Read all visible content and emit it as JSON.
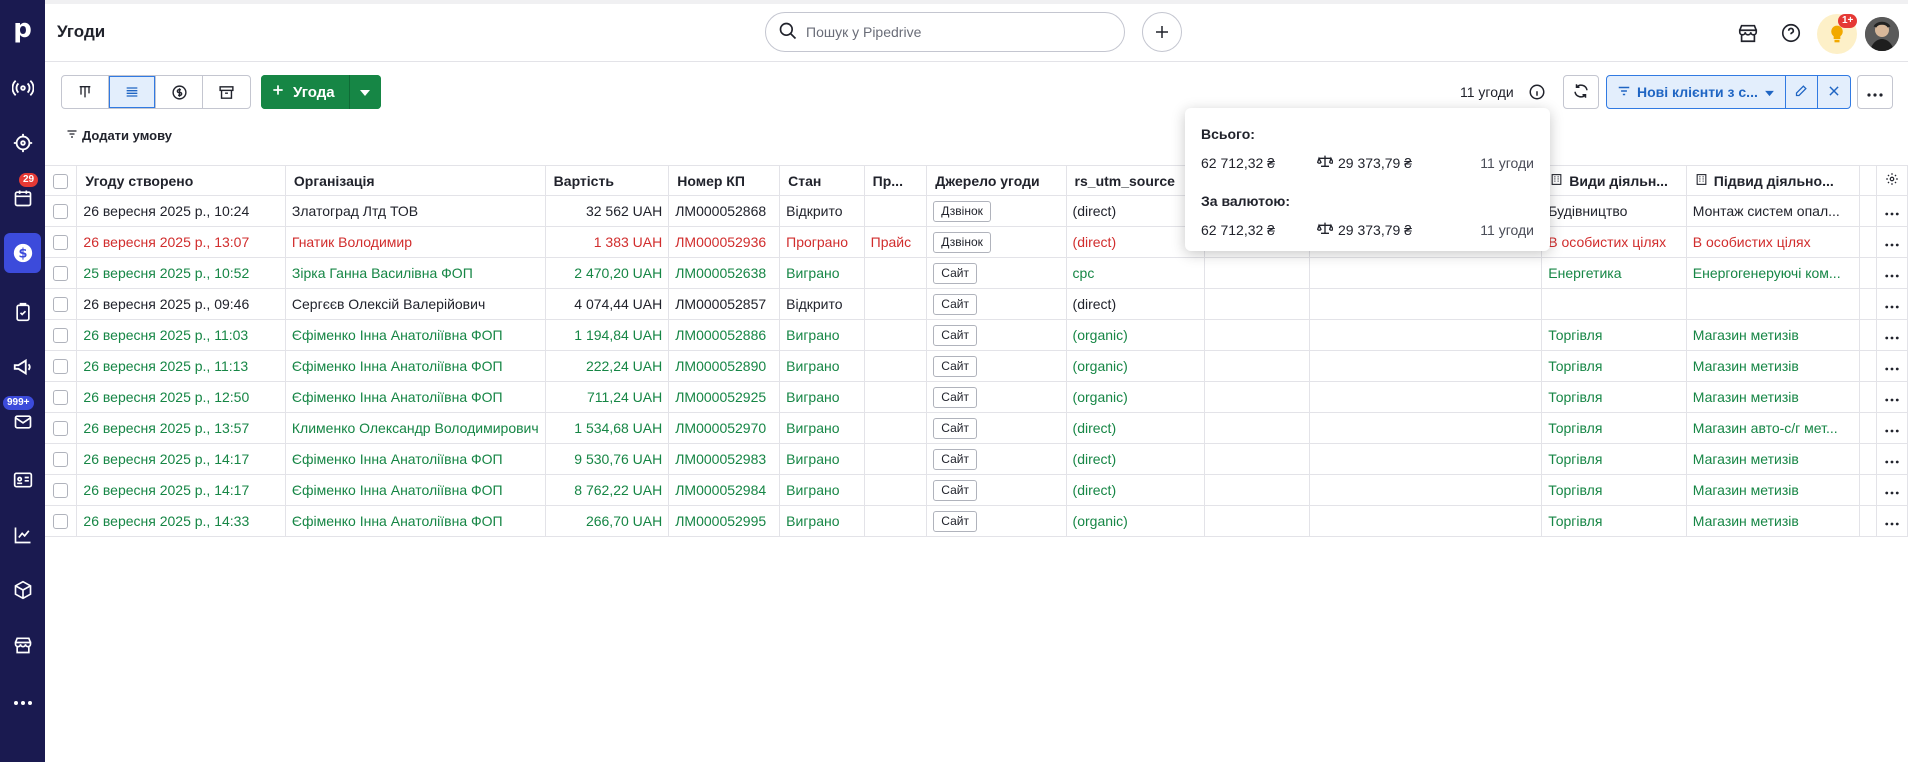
{
  "app": {
    "title": "Угоди"
  },
  "search": {
    "placeholder": "Пошук у Pipedrive"
  },
  "notifications": {
    "badge": "1+"
  },
  "sidebar": {
    "badges": {
      "activities": "29",
      "mail": "999+"
    }
  },
  "toolbar": {
    "add_deal_label": "Угода",
    "deal_count": "11 угоди",
    "filter_label": "Нові клієнти з с...",
    "add_condition": "Додати умову"
  },
  "table": {
    "columns": [
      "Угоду створено",
      "Організація",
      "Вартість",
      "Номер КП",
      "Стан",
      "Пр...",
      "Джерело угоди",
      "rs_utm_source",
      "rs",
      "",
      "Види діяльн...",
      "Підвид діяльно..."
    ],
    "rows": [
      {
        "created": "26 вересня 2025 р., 10:24",
        "org": "Златоград Лтд ТОВ",
        "value": "32 562 UAH",
        "kp": "ЛМ000052868",
        "status": "Відкрито",
        "pr": "",
        "source": "Дзвінок",
        "utm": "(direct)",
        "rs": "(d",
        "activity": "Будівництво",
        "sub": "Монтаж систем опал...",
        "color": "k"
      },
      {
        "created": "26 вересня 2025 р., 13:07",
        "org": "Гнатик Володимир",
        "value": "1 383 UAH",
        "kp": "ЛМ000052936",
        "status": "Програно",
        "pr": "Прайс",
        "source": "Дзвінок",
        "utm": "(direct)",
        "rs": "(d",
        "activity": "В особистих цілях",
        "sub": "В особистих цілях",
        "color": "r"
      },
      {
        "created": "25 вересня 2025 р., 10:52",
        "org": "Зірка Ганна Василівна ФОП",
        "value": "2 470,20 UAH",
        "kp": "ЛМ000052638",
        "status": "Виграно",
        "pr": "",
        "source": "Сайт",
        "utm": "cpc",
        "rs": "",
        "activity": "Енергетика",
        "sub": "Енергогенеруючі ком...",
        "color": "g"
      },
      {
        "created": "26 вересня 2025 р., 09:46",
        "org": "Сергєєв Олексій Валерійович",
        "value": "4 074,44 UAH",
        "kp": "ЛМ000052857",
        "status": "Відкрито",
        "pr": "",
        "source": "Сайт",
        "utm": "(direct)",
        "rs": "",
        "activity": "",
        "sub": "",
        "color": "k"
      },
      {
        "created": "26 вересня 2025 р., 11:03",
        "org": "Єфіменко Інна Анатоліївна ФОП",
        "value": "1 194,84 UAH",
        "kp": "ЛМ000052886",
        "status": "Виграно",
        "pr": "",
        "source": "Сайт",
        "utm": "(organic)",
        "rs": "",
        "activity": "Торгівля",
        "sub": "Магазин метизів",
        "color": "g"
      },
      {
        "created": "26 вересня 2025 р., 11:13",
        "org": "Єфіменко Інна Анатоліївна ФОП",
        "value": "222,24 UAH",
        "kp": "ЛМ000052890",
        "status": "Виграно",
        "pr": "",
        "source": "Сайт",
        "utm": "(organic)",
        "rs": "",
        "activity": "Торгівля",
        "sub": "Магазин метизів",
        "color": "g"
      },
      {
        "created": "26 вересня 2025 р., 12:50",
        "org": "Єфіменко Інна Анатоліївна ФОП",
        "value": "711,24 UAH",
        "kp": "ЛМ000052925",
        "status": "Виграно",
        "pr": "",
        "source": "Сайт",
        "utm": "(organic)",
        "rs": "",
        "activity": "Торгівля",
        "sub": "Магазин метизів",
        "color": "g"
      },
      {
        "created": "26 вересня 2025 р., 13:57",
        "org": "Клименко Олександр Володимирович",
        "value": "1 534,68 UAH",
        "kp": "ЛМ000052970",
        "status": "Виграно",
        "pr": "",
        "source": "Сайт",
        "utm": "(direct)",
        "rs": "",
        "activity": "Торгівля",
        "sub": "Магазин авто-с/г мет...",
        "color": "g"
      },
      {
        "created": "26 вересня 2025 р., 14:17",
        "org": "Єфіменко Інна Анатоліївна ФОП",
        "value": "9 530,76 UAH",
        "kp": "ЛМ000052983",
        "status": "Виграно",
        "pr": "",
        "source": "Сайт",
        "utm": "(direct)",
        "rs": "",
        "activity": "Торгівля",
        "sub": "Магазин метизів",
        "color": "g"
      },
      {
        "created": "26 вересня 2025 р., 14:17",
        "org": "Єфіменко Інна Анатоліївна ФОП",
        "value": "8 762,22 UAH",
        "kp": "ЛМ000052984",
        "status": "Виграно",
        "pr": "",
        "source": "Сайт",
        "utm": "(direct)",
        "rs": "",
        "activity": "Торгівля",
        "sub": "Магазин метизів",
        "color": "g"
      },
      {
        "created": "26 вересня 2025 р., 14:33",
        "org": "Єфіменко Інна Анатоліївна ФОП",
        "value": "266,70 UAH",
        "kp": "ЛМ000052995",
        "status": "Виграно",
        "pr": "",
        "source": "Сайт",
        "utm": "(organic)",
        "rs": "",
        "activity": "Торгівля",
        "sub": "Магазин метизів",
        "color": "g"
      }
    ]
  },
  "popup": {
    "total_label": "Всього:",
    "total": {
      "sum": "62 712,32 ₴",
      "weighted": "29 373,79 ₴",
      "count": "11 угоди"
    },
    "currency_label": "За валютою:",
    "currency": {
      "sum": "62 712,32 ₴",
      "weighted": "29 373,79 ₴",
      "count": "11 угоди"
    }
  },
  "colors": {
    "sidebar": "#1a1a50",
    "accent": "#3c4bdb",
    "green": "#168645",
    "red": "#d12d2d",
    "filter": "#317ae2"
  }
}
